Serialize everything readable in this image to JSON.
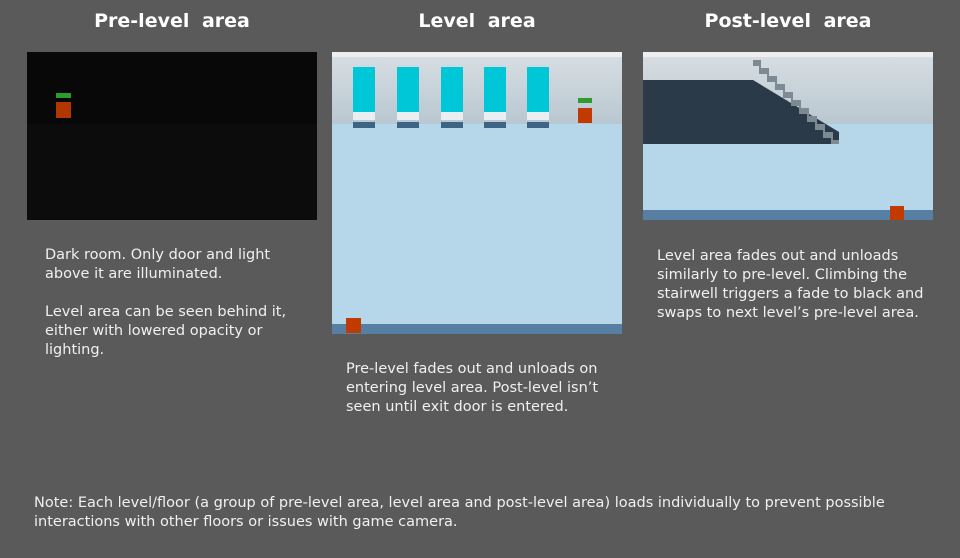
{
  "columns": [
    {
      "title": "Pre-level area",
      "description": "Dark room. Only door and light above it are illuminated.\n\nLevel area can be seen behind it, either with lowered opacity or lighting."
    },
    {
      "title": "Level area",
      "description": "Pre-level fades out and unloads on entering level area. Post-level isn’t seen until exit door is entered."
    },
    {
      "title": "Post-level area",
      "description": "Level area fades out and unloads similarly to pre-level. Climbing the stairwell triggers a fade to black and swaps to next level’s pre-level area."
    }
  ],
  "note": "Note: Each level/floor (a group of pre-level area, level area and post-level area) loads individually to prevent possible interactions with other floors or issues with game camera.",
  "colors": {
    "background": "#5a5a5a",
    "dark_room": "#0b0b0b",
    "floor_blue": "#b6d7ea",
    "wall_blue": "#c3cfd8",
    "window_cyan": "#00c7d8",
    "door_orange": "#c13b00",
    "light_green": "#2e9b2e"
  }
}
